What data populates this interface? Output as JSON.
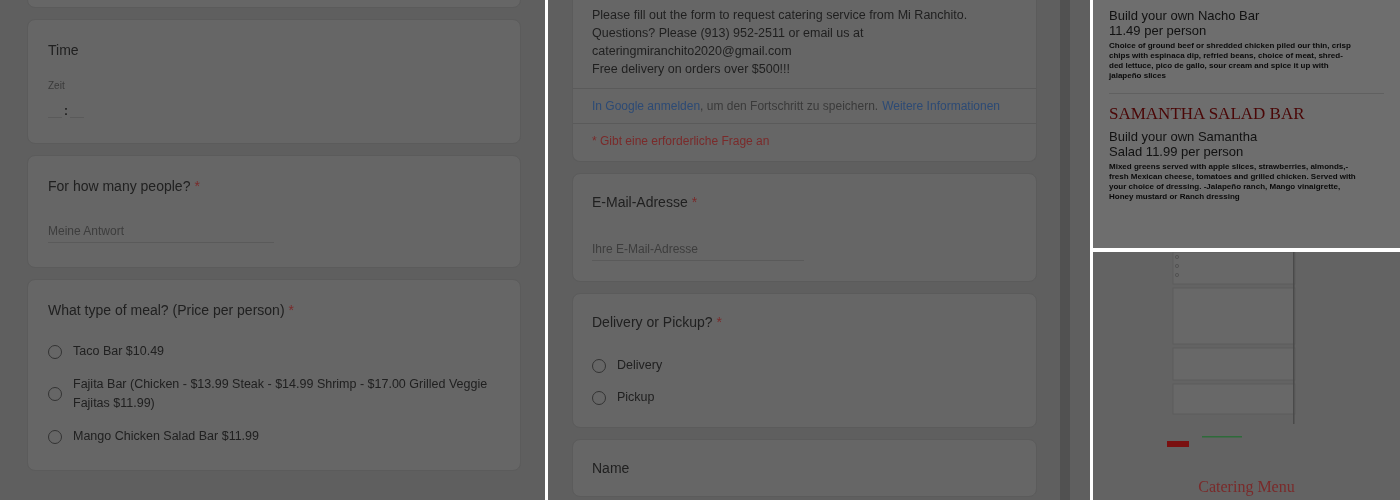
{
  "left_form": {
    "cards": [
      {
        "kind": "cut_field"
      },
      {
        "kind": "time",
        "title": "Time",
        "sublabel": "Zeit",
        "separator": ":"
      },
      {
        "kind": "text",
        "title": "For how many people?",
        "mark": "*",
        "placeholder": "Meine Antwort"
      },
      {
        "kind": "choice",
        "title": "What type of meal? (Price per person)",
        "mark": "*",
        "options": [
          {
            "label": "Taco Bar $10.49",
            "selected": false
          },
          {
            "label": "Fajita Bar (Chicken - $13.99 Steak - $14.99 Shrimp - $17.00 Grilled Veggie Fajitas $11.99)",
            "selected": false
          },
          {
            "label": "Mango Chicken Salad Bar $11.99",
            "selected": false
          }
        ]
      }
    ]
  },
  "middle_form": {
    "intro": {
      "lines": [
        "Please fill out the form to request catering service from Mi Ranchito.",
        "Questions? Please (913) 952-2511 or email us at",
        "cateringmiranchito2020@gmail.com",
        "Free delivery on orders over $500!!!"
      ],
      "signin_link": "In Google anmelden",
      "signin_text": ", um den Fortschritt zu speichern.",
      "more_link": "Weitere Informationen",
      "required_note": "* Gibt eine erforderliche Frage an"
    },
    "cards": [
      {
        "kind": "text",
        "title": "E-Mail-Adresse",
        "mark": "*",
        "placeholder": "Ihre E-Mail-Adresse"
      },
      {
        "kind": "choice",
        "title": "Delivery or Pickup?",
        "mark": "*",
        "options": [
          {
            "label": "Delivery",
            "selected": false
          },
          {
            "label": "Pickup",
            "selected": false
          }
        ]
      },
      {
        "kind": "title_only",
        "title": "Name"
      }
    ]
  },
  "menu": {
    "items": [
      {
        "subtitle": [
          "Build your own Nacho Bar",
          "11.49 per person"
        ],
        "description": [
          "Choice of ground beef or shredded chicken piled our thin, crisp",
          "chips with espinaca dip, refried beans, choice of meat, shred-",
          "ded lettuce, pico de gallo, sour cream and spice it up with",
          "jalapeño slices"
        ]
      },
      {
        "heading": "SAMANTHA SALAD BAR",
        "subtitle": [
          "Build your own Samantha",
          "Salad 11.99 per person"
        ],
        "description": [
          "Mixed greens served with apple slices, strawberries, almonds,-",
          "fresh Mexican cheese, tomatoes and grilled chicken. Served with",
          "your choice of dressing. -Jalapeño ranch, Mango vinaigrette,",
          "Honey mustard or Ranch dressing"
        ]
      }
    ]
  },
  "catering_page": {
    "title": "Catering Menu"
  }
}
